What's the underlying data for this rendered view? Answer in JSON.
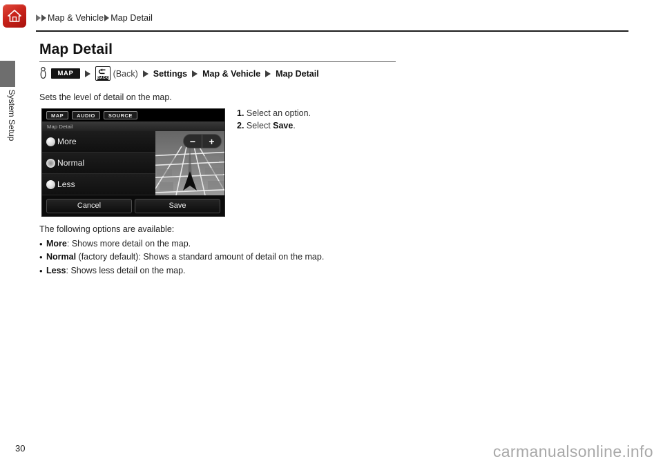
{
  "header": {
    "home_icon": "home-icon",
    "breadcrumb": [
      {
        "type": "arrow"
      },
      {
        "type": "arrow"
      },
      {
        "type": "text",
        "label": "Map & Vehicle"
      },
      {
        "type": "arrow"
      },
      {
        "type": "text",
        "label": "Map Detail"
      }
    ]
  },
  "sidebar": {
    "section_label": "System Setup"
  },
  "page_title": "Map Detail",
  "nav_path": {
    "hand_icon": "pointing-hand-icon",
    "map_key": "MAP",
    "back_key": "BACK",
    "back_caption": "(Back)",
    "settings": "Settings",
    "map_and_vehicle": "Map & Vehicle",
    "map_detail": "Map Detail"
  },
  "lead_text": "Sets the level of detail on the map.",
  "steps": [
    {
      "num": "1.",
      "text": "Select an option.",
      "bold_tail": ""
    },
    {
      "num": "2.",
      "text": "Select ",
      "bold": "Save",
      "tail": "."
    }
  ],
  "nav_screenshot": {
    "tabs": [
      "MAP",
      "AUDIO",
      "SOURCE"
    ],
    "subtitle": "Map Detail",
    "options": [
      {
        "label": "More",
        "selected": false
      },
      {
        "label": "Normal",
        "selected": true
      },
      {
        "label": "Less",
        "selected": false
      }
    ],
    "zoom_out": "−",
    "zoom_in": "+",
    "cancel_button": "Cancel",
    "save_button": "Save"
  },
  "options_section": {
    "intro": "The following options are available:",
    "items": [
      {
        "name": "More",
        "desc": ": Shows more detail on the map."
      },
      {
        "name": "Normal",
        "desc": " (factory default): Shows a standard amount of detail on the map."
      },
      {
        "name": "Less",
        "desc": ": Shows less detail on the map."
      }
    ]
  },
  "footer": {
    "page_number": "30",
    "watermark": "carmanualsonline.info"
  },
  "colors": {
    "home_red": "#c9241b",
    "side_tab_gray": "#6e6e6e",
    "rule_dark": "#1c1c1c",
    "watermark_gray": "#a8a8a8"
  }
}
